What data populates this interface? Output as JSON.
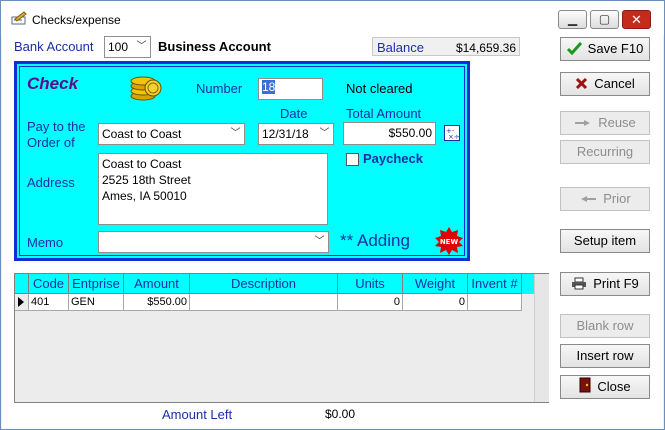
{
  "window": {
    "title": "Checks/expense"
  },
  "header": {
    "bank_account_label": "Bank Account",
    "bank_account_value": "100",
    "bank_account_name": "Business Account",
    "balance_label": "Balance",
    "balance_value": "$14,659.36"
  },
  "check": {
    "heading": "Check",
    "number_label": "Number",
    "number_value": "18",
    "status": "Not cleared",
    "pay_to_label_1": "Pay to the",
    "pay_to_label_2": "Order of",
    "payee": "Coast to Coast",
    "date_label": "Date",
    "date_value": "12/31/18",
    "total_label": "Total Amount",
    "total_value": "$550.00",
    "paycheck_label": "Paycheck",
    "address_label": "Address",
    "address_line_1": "Coast to Coast",
    "address_line_2": "2525 18th Street",
    "address_line_3": "Ames, IA 50010",
    "memo_label": "Memo",
    "memo_value": "",
    "mode_text": "** Adding",
    "new_badge": "NEW"
  },
  "buttons": {
    "save": "Save F10",
    "cancel": "Cancel",
    "reuse": "Reuse",
    "recurring": "Recurring",
    "prior": "Prior",
    "setup_item": "Setup item",
    "print": "Print  F9",
    "blank_row": "Blank row",
    "insert_row": "Insert row",
    "close": "Close"
  },
  "grid": {
    "columns": [
      "Code",
      "Entprise",
      "Amount",
      "Description",
      "Units",
      "Weight",
      "Invent #"
    ],
    "rows": [
      {
        "code": "401",
        "entprise": "GEN",
        "amount": "$550.00",
        "description": "",
        "units": "0",
        "weight": "0",
        "invent": ""
      }
    ]
  },
  "footer": {
    "amount_left_label": "Amount Left",
    "amount_left_value": "$0.00"
  },
  "colors": {
    "panel": "#00ffff",
    "panel_border": "#0d2fd4",
    "label_blue": "#1a2fa8",
    "new_badge": "#e00000"
  }
}
